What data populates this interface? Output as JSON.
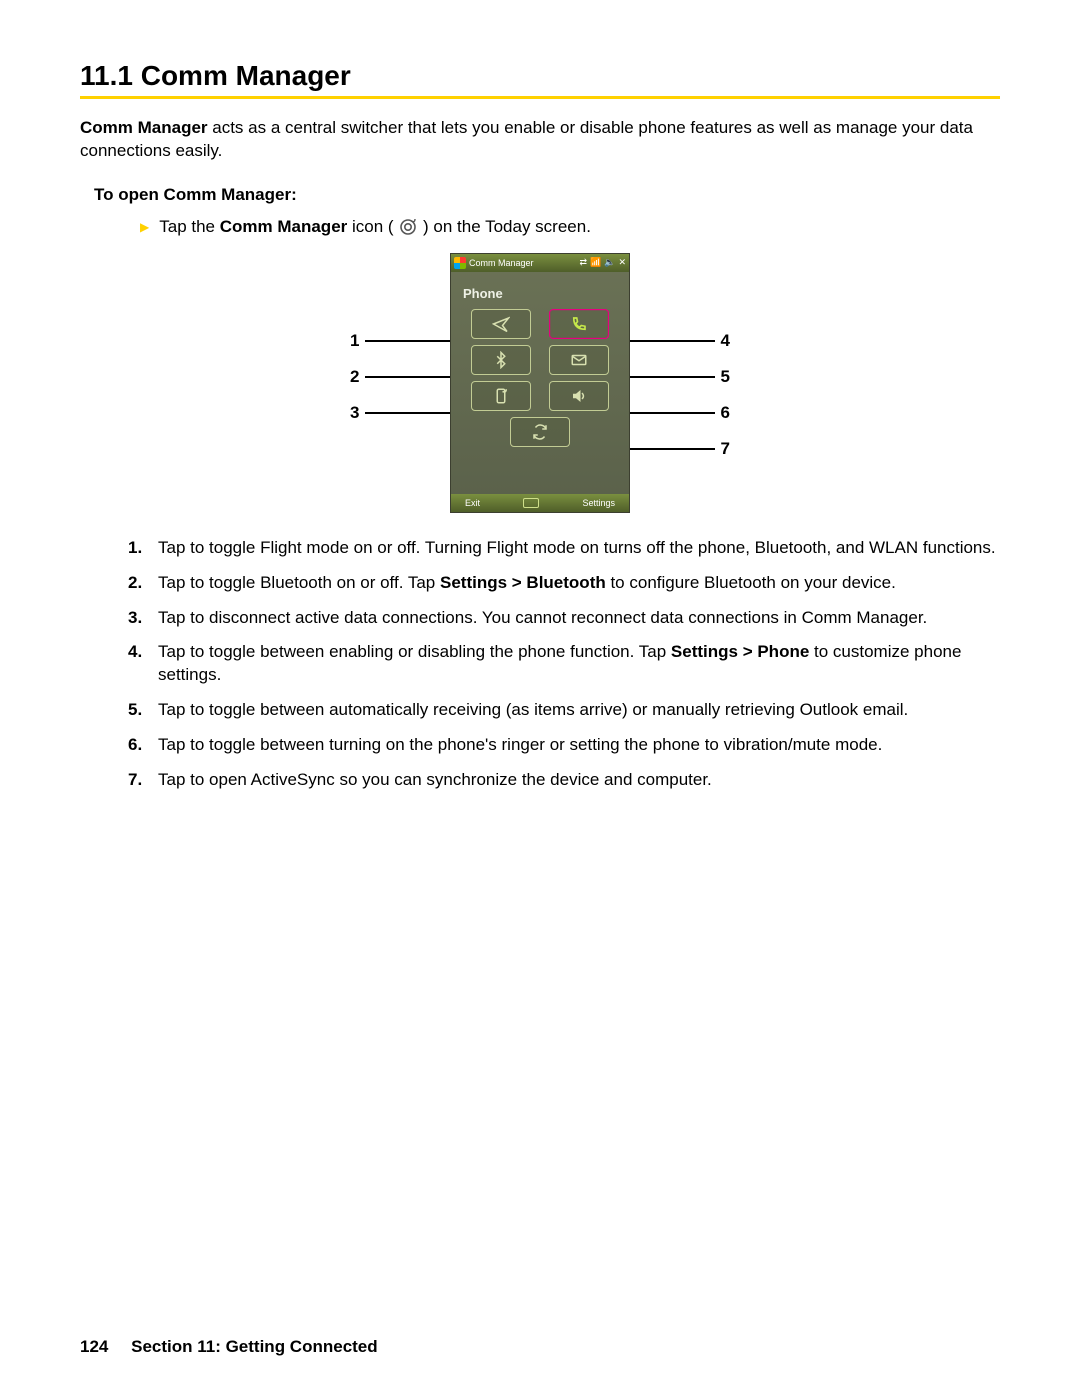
{
  "heading": "11.1  Comm Manager",
  "intro_bold": "Comm Manager",
  "intro_rest": " acts as a central switcher that lets you enable or disable phone features as well as manage your data connections easily.",
  "subhead": "To open Comm Manager:",
  "bullet_pre": "Tap the ",
  "bullet_bold": "Comm Manager",
  "bullet_mid": " icon ( ",
  "bullet_post": " ) on the Today screen.",
  "callouts": {
    "c1": "1",
    "c2": "2",
    "c3": "3",
    "c4": "4",
    "c5": "5",
    "c6": "6",
    "c7": "7"
  },
  "device": {
    "title": "Comm Manager",
    "phone_label": "Phone",
    "soft_left": "Exit",
    "soft_right": "Settings"
  },
  "list": {
    "i1": "Tap to toggle Flight mode on or off. Turning Flight mode on turns off the phone, Bluetooth, and WLAN functions.",
    "i2_pre": "Tap to toggle Bluetooth on or off. Tap ",
    "i2_bold": "Settings > Bluetooth",
    "i2_post": " to configure Bluetooth on your device.",
    "i3": "Tap to disconnect active data connections. You cannot reconnect data connections in Comm Manager.",
    "i4_pre": "Tap to toggle between enabling or disabling the phone function. Tap ",
    "i4_bold": "Settings > Phone",
    "i4_post": " to customize phone settings.",
    "i5": "Tap to toggle between automatically receiving (as items arrive) or manually retrieving Outlook email.",
    "i6": "Tap to toggle between turning on the phone's ringer or setting the phone to vibration/mute mode.",
    "i7": "Tap to open ActiveSync so you can synchronize the device and computer."
  },
  "footer": {
    "page": "124",
    "section": "Section 11: Getting Connected"
  }
}
